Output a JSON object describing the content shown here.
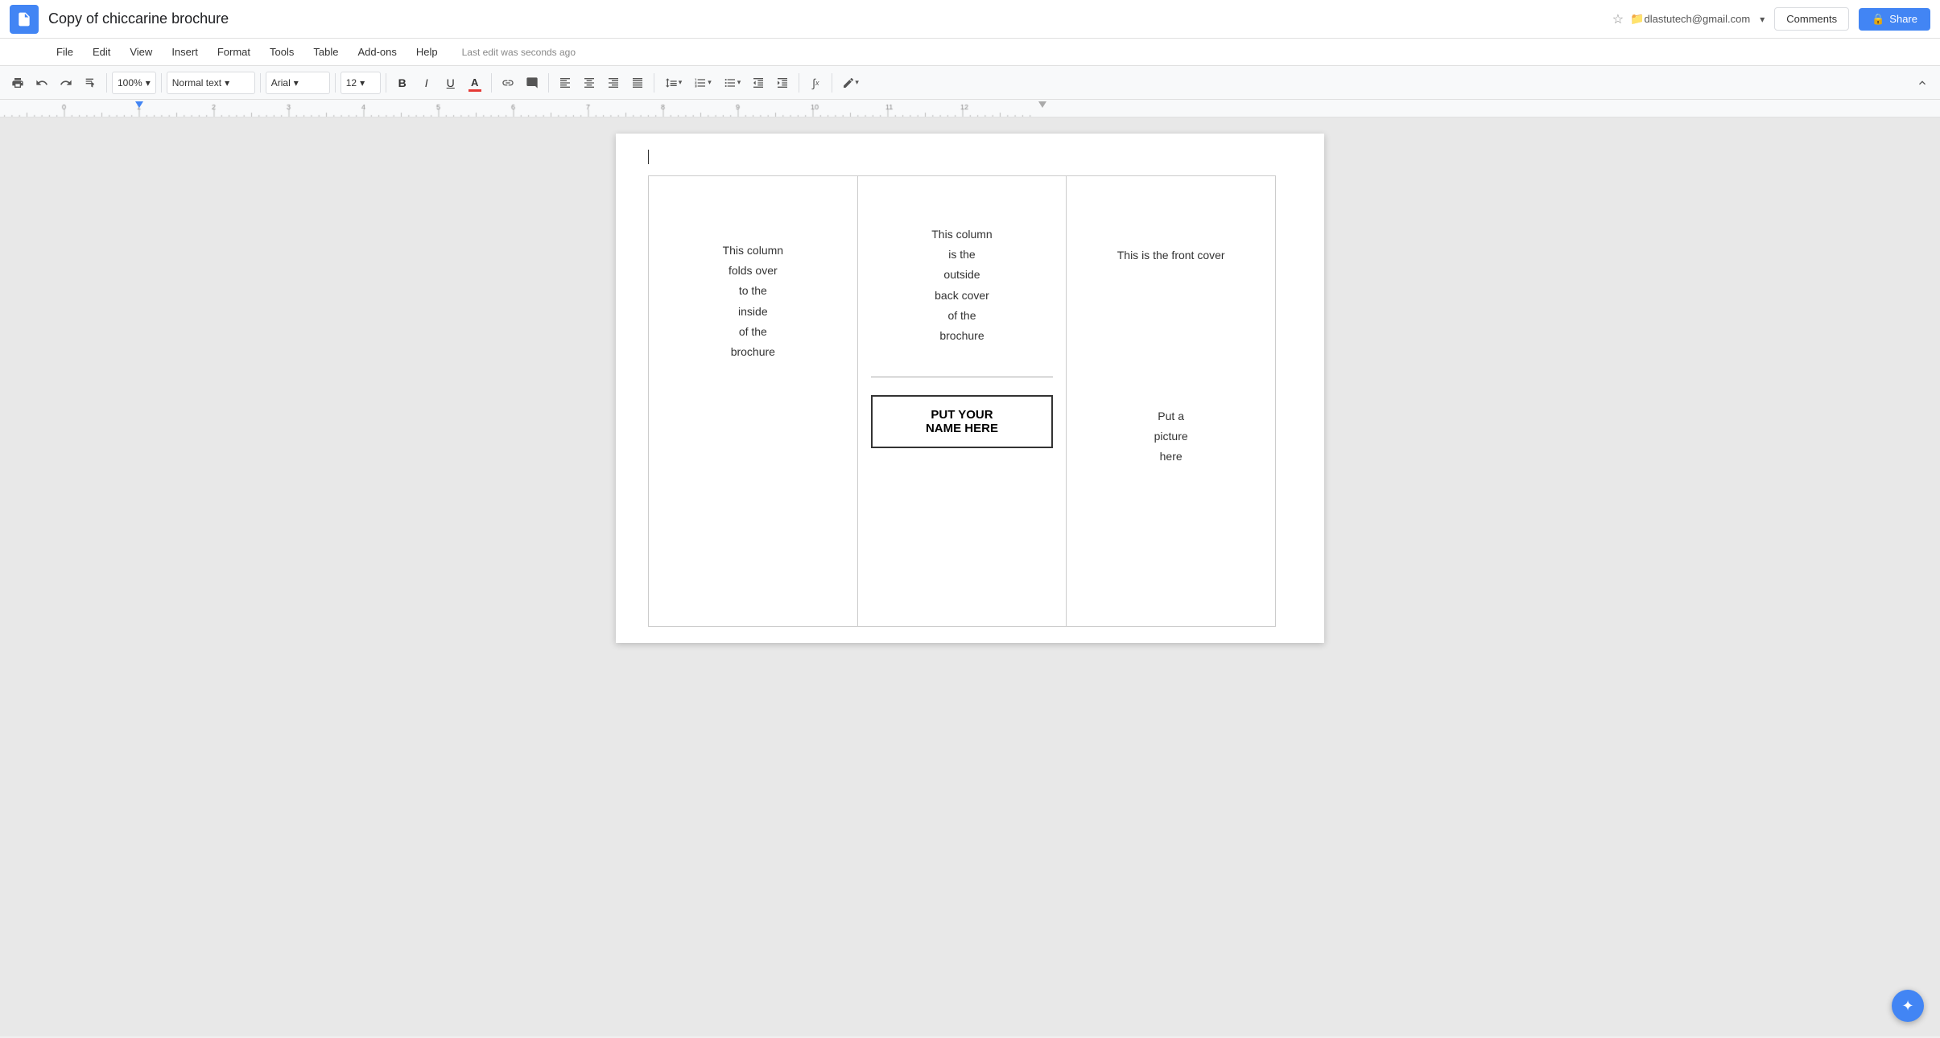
{
  "app": {
    "icon_color": "#4285f4",
    "title": "Copy of chiccarine brochure",
    "star_label": "★",
    "folder_label": "📁"
  },
  "user": {
    "email": "dlastutech@gmail.com",
    "dropdown_arrow": "▾"
  },
  "buttons": {
    "comments": "Comments",
    "share": "Share",
    "share_icon": "🔒"
  },
  "menu": {
    "items": [
      "File",
      "Edit",
      "View",
      "Insert",
      "Format",
      "Tools",
      "Table",
      "Add-ons",
      "Help"
    ],
    "last_edit": "Last edit was seconds ago"
  },
  "toolbar": {
    "zoom": "100%",
    "style": "Normal text",
    "font": "Arial",
    "size": "12",
    "bold": "B",
    "italic": "I",
    "underline": "U"
  },
  "document": {
    "col1": {
      "text": "This column\nfolds over\nto the\ninside\nof the\nbrochure"
    },
    "col2": {
      "top_text": "This column\nis the\noutside\nback cover\nof the\nbrochure",
      "name_box": "PUT YOUR\nNAME HERE"
    },
    "col3": {
      "front_cover": "This is the front cover",
      "picture_here": "Put a\npicture\nhere"
    }
  },
  "smart_compose": {
    "icon": "✦"
  }
}
